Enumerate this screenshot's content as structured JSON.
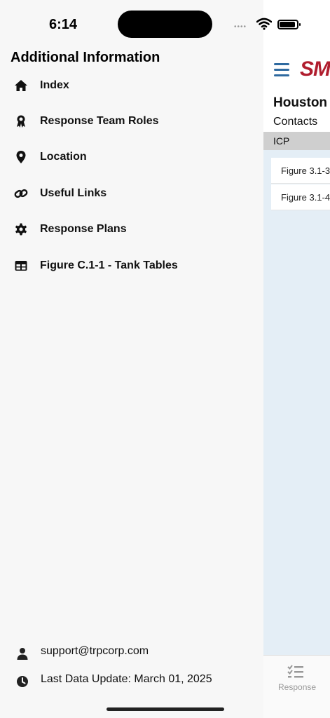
{
  "status_bar": {
    "time": "6:14",
    "dots": "••••"
  },
  "drawer": {
    "title": "Additional Information",
    "items": [
      {
        "label": "Index",
        "icon": "home-icon"
      },
      {
        "label": "Response Team Roles",
        "icon": "award-icon"
      },
      {
        "label": "Location",
        "icon": "location-pin-icon"
      },
      {
        "label": "Useful Links",
        "icon": "link-icon"
      },
      {
        "label": "Response Plans",
        "icon": "gear-icon"
      },
      {
        "label": "Figure C.1-1 - Tank Tables",
        "icon": "table-icon"
      }
    ],
    "footer": {
      "support_email": "support@trpcorp.com",
      "last_update": "Last Data Update: March 01, 2025"
    }
  },
  "background_app": {
    "brand_text": "SM",
    "heading": "Houston",
    "subheading": "Contacts",
    "section_label": "ICP",
    "figures": [
      "Figure 3.1-3",
      "Figure 3.1-4"
    ],
    "tab_label": "Response",
    "colors": {
      "brand": "#b01d2e",
      "accent": "#2f6aa0",
      "content_bg": "#e4eef6"
    }
  }
}
